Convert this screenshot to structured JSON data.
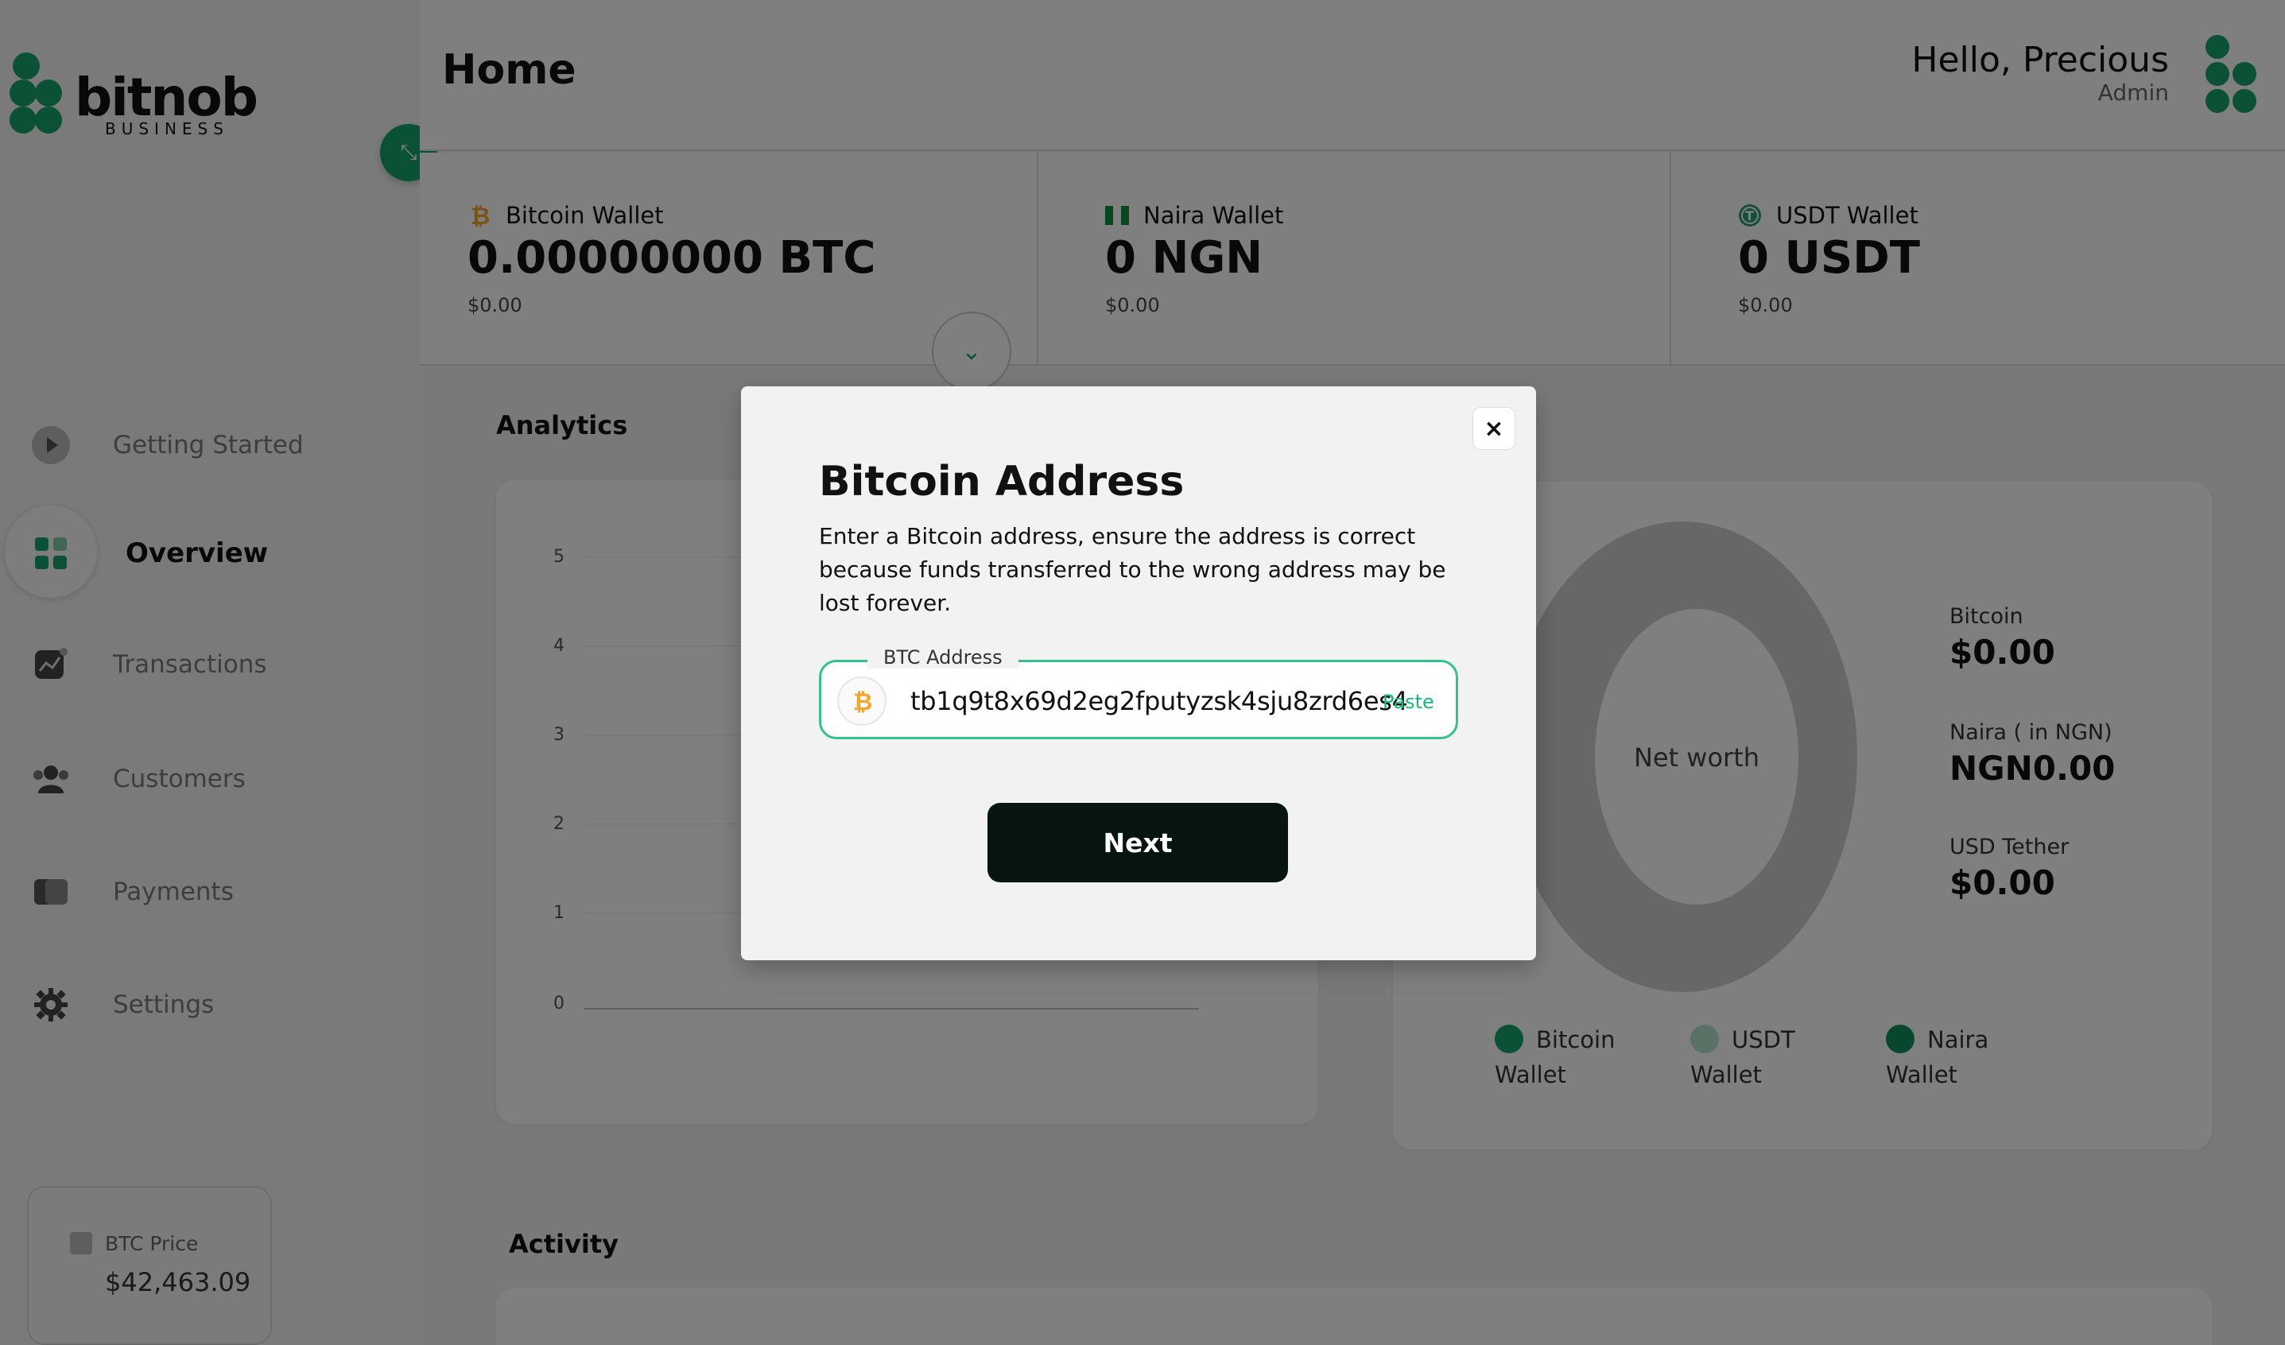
{
  "brand": {
    "name": "bitnob",
    "sub": "BUSINESS",
    "color": "#16a36b"
  },
  "header": {
    "title": "Home",
    "greeting": "Hello, Precious",
    "role": "Admin"
  },
  "sidebar": {
    "items": [
      {
        "label": "Getting Started",
        "icon": "play-icon"
      },
      {
        "label": "Overview",
        "icon": "grid-icon",
        "active": true
      },
      {
        "label": "Transactions",
        "icon": "chart-icon"
      },
      {
        "label": "Customers",
        "icon": "users-icon"
      },
      {
        "label": "Payments",
        "icon": "cards-icon"
      },
      {
        "label": "Settings",
        "icon": "gear-icon"
      }
    ],
    "btc_price": {
      "label": "BTC Price",
      "value": "$42,463.09"
    }
  },
  "wallets": [
    {
      "name": "Bitcoin Wallet",
      "amount": "0.00000000 BTC",
      "usd": "$0.00",
      "icon": "bitcoin-icon"
    },
    {
      "name": "Naira Wallet",
      "amount": "0 NGN",
      "usd": "$0.00",
      "icon": "nigeria-flag-icon"
    },
    {
      "name": "USDT Wallet",
      "amount": "0 USDT",
      "usd": "$0.00",
      "icon": "tether-icon"
    }
  ],
  "analytics": {
    "title": "Analytics",
    "y_ticks": [
      "5",
      "4",
      "3",
      "2",
      "1",
      "0"
    ]
  },
  "networth": {
    "center_label": "Net worth",
    "items": [
      {
        "label": "Bitcoin",
        "value": "$0.00"
      },
      {
        "label": "Naira ( in NGN)",
        "value": "NGN0.00"
      },
      {
        "label": "USD Tether",
        "value": "$0.00"
      }
    ],
    "legend": [
      {
        "line1": "Bitcoin",
        "line2": "Wallet",
        "color": "#16a36b"
      },
      {
        "line1": "USDT",
        "line2": "Wallet",
        "color": "#b7e3cc"
      },
      {
        "line1": "Naira",
        "line2": "Wallet",
        "color": "#0f8f5a"
      }
    ]
  },
  "activity": {
    "title": "Activity"
  },
  "modal": {
    "title": "Bitcoin Address",
    "description": "Enter a Bitcoin address, ensure the address is correct because funds transferred to the wrong address may be lost forever.",
    "field_label": "BTC Address",
    "field_value": "tb1q9t8x69d2eg2fputyzsk4sju8zrd6es4",
    "paste_label": "Paste",
    "next_label": "Next",
    "close_label": "×"
  }
}
